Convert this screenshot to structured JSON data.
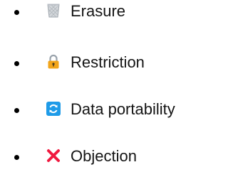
{
  "items": [
    {
      "label": "Erasure",
      "icon": "wastebasket-icon"
    },
    {
      "label": "Restriction",
      "icon": "lock-icon"
    },
    {
      "label": "Data portability",
      "icon": "refresh-icon"
    },
    {
      "label": "Objection",
      "icon": "cross-mark-icon"
    }
  ],
  "colors": {
    "text": "#141414",
    "bullet": "#000000",
    "lock_body": "#F2A51A",
    "refresh_bg": "#1E9BE8",
    "cross": "#F0193F",
    "basket": "#B8BEC4"
  }
}
